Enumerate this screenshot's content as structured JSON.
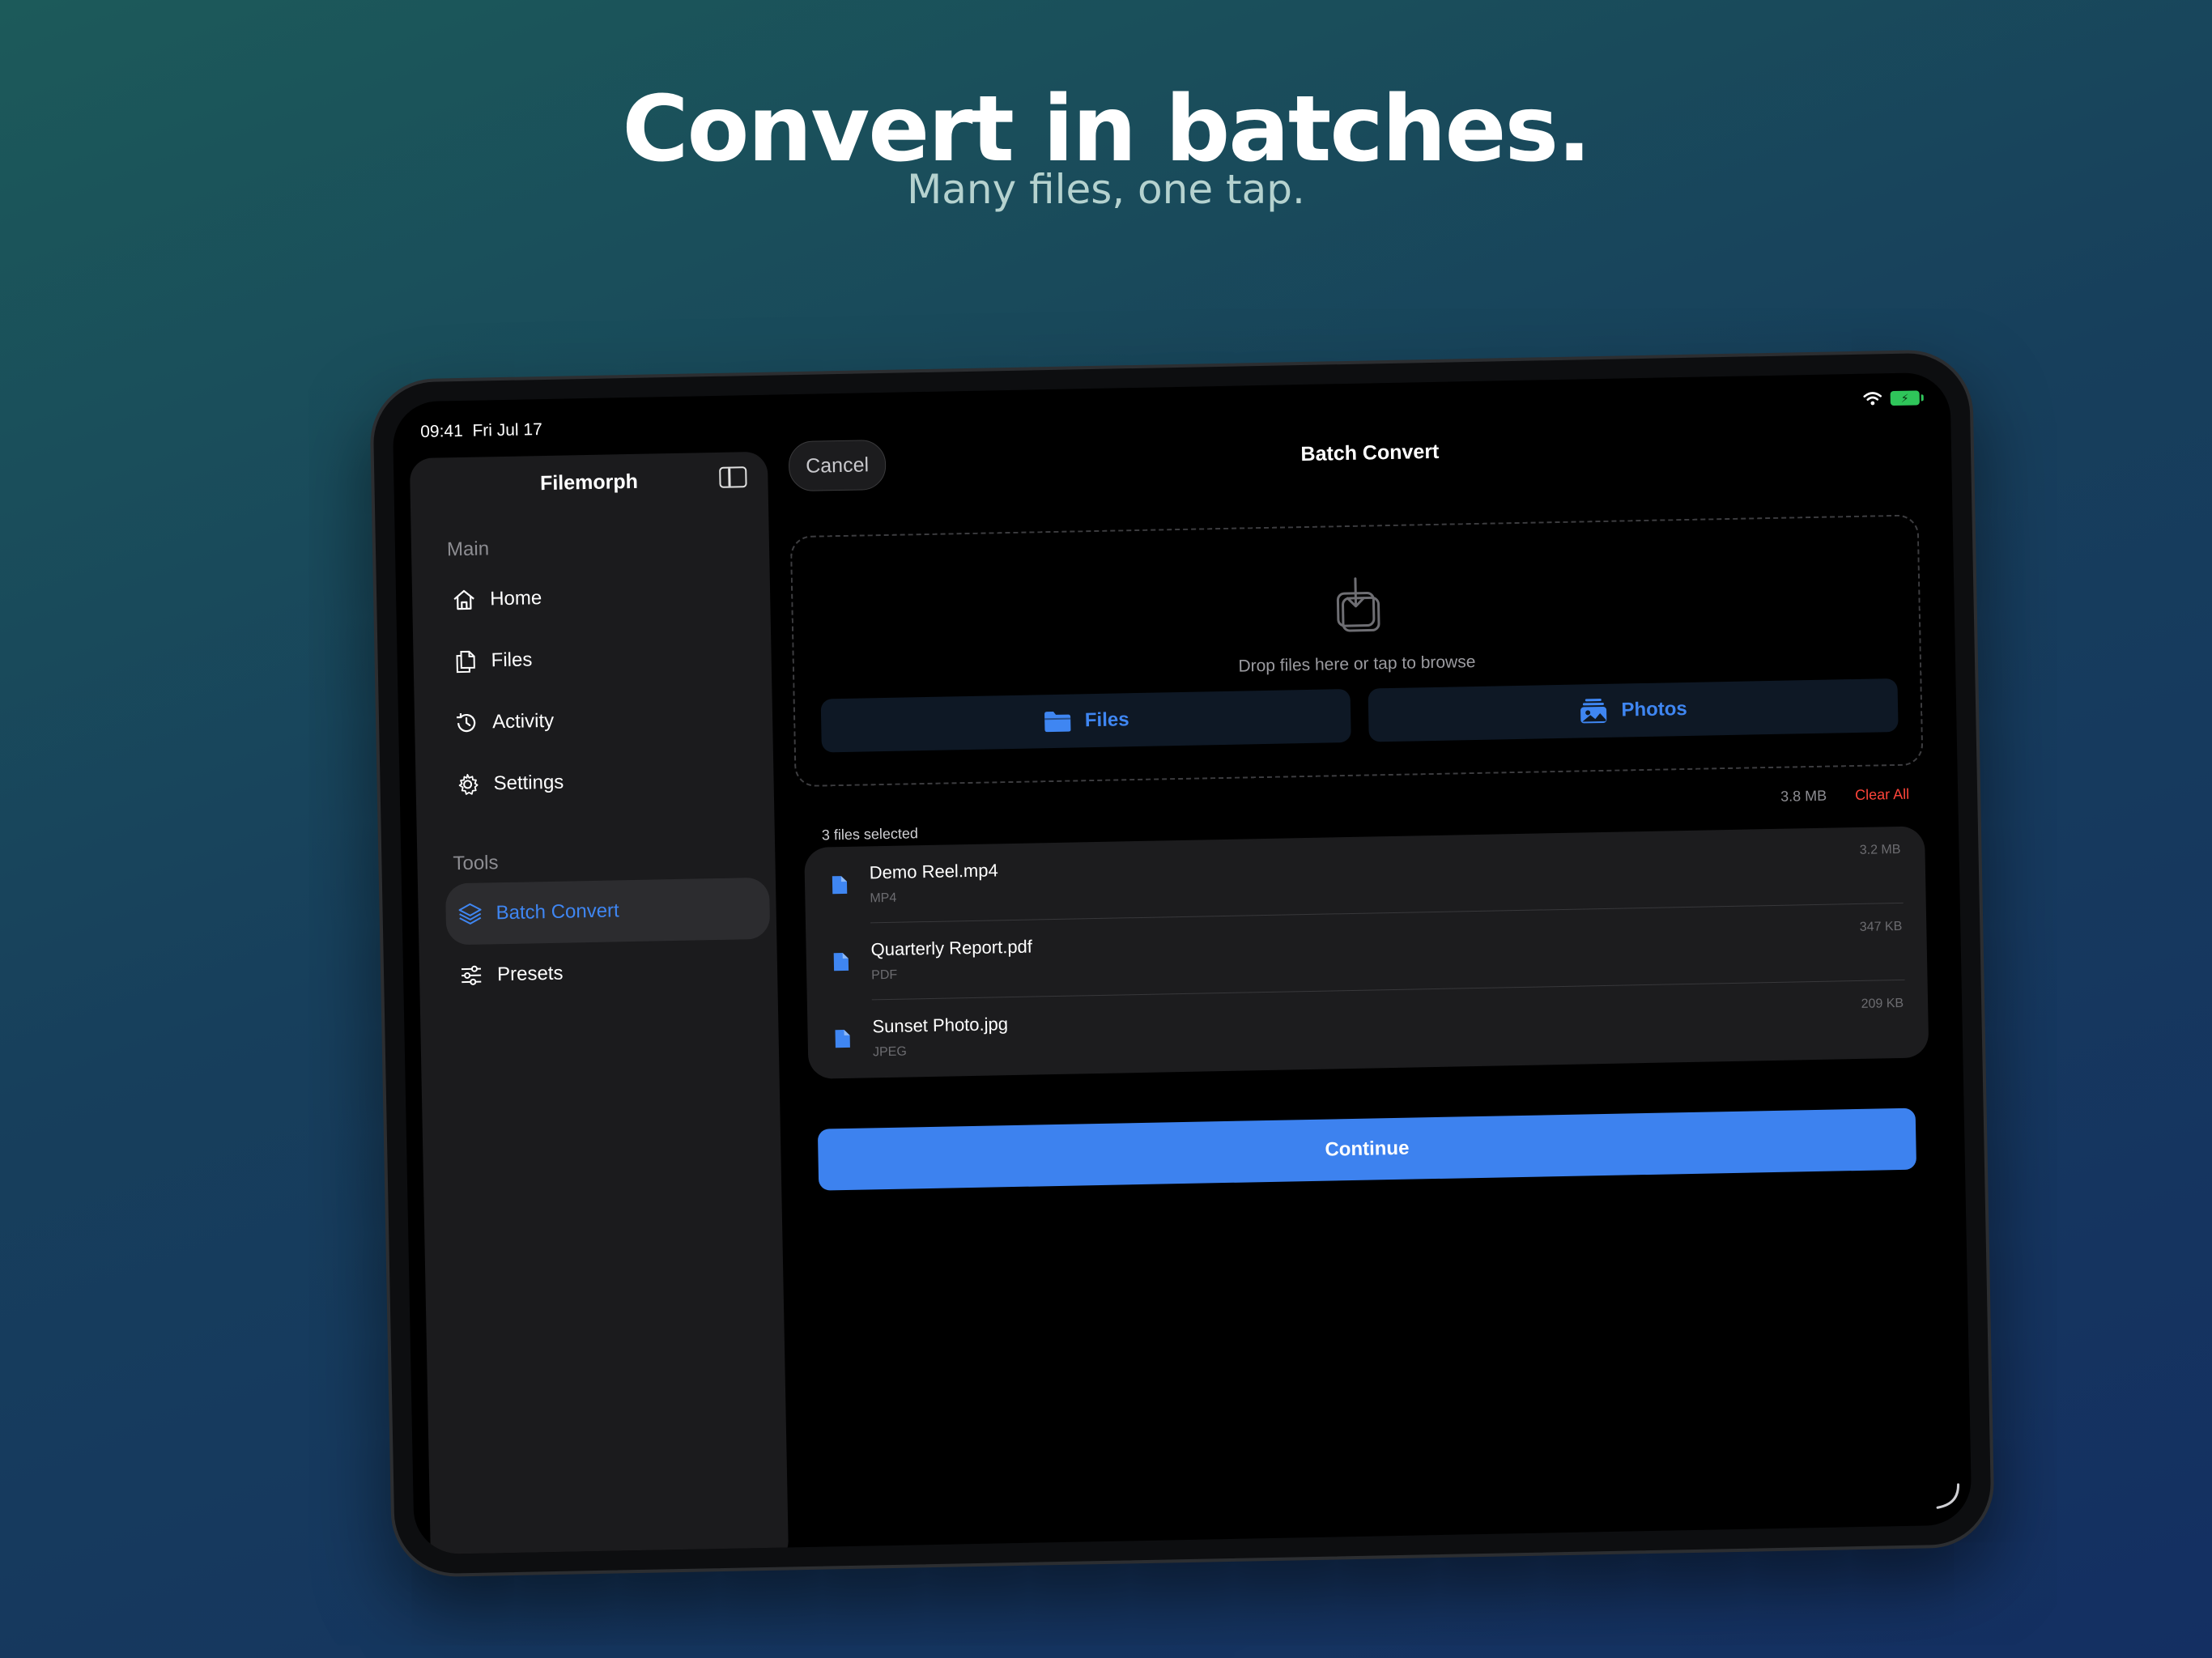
{
  "marketing": {
    "headline": "Convert in batches.",
    "subheadline": "Many files, one tap."
  },
  "status_bar": {
    "time": "09:41",
    "date": "Fri Jul 17",
    "wifi_icon": "wifi-icon",
    "battery_icon": "battery-charging-icon",
    "battery_color": "#2fc55a"
  },
  "sidebar": {
    "title": "Filemorph",
    "toggle_icon": "sidebar-toggle-icon",
    "sections": [
      {
        "label": "Main",
        "items": [
          {
            "label": "Home",
            "icon": "house-icon"
          },
          {
            "label": "Files",
            "icon": "documents-icon"
          },
          {
            "label": "Activity",
            "icon": "clock-history-icon"
          },
          {
            "label": "Settings",
            "icon": "gear-icon"
          }
        ]
      },
      {
        "label": "Tools",
        "items": [
          {
            "label": "Batch Convert",
            "icon": "layers-icon",
            "selected": true
          },
          {
            "label": "Presets",
            "icon": "sliders-icon"
          }
        ]
      }
    ]
  },
  "nav": {
    "cancel_label": "Cancel",
    "title": "Batch Convert"
  },
  "dropzone": {
    "icon": "download-tray-icon",
    "hint": "Drop files here or tap to browse",
    "files_button": "Files",
    "photos_button": "Photos"
  },
  "selection": {
    "count_label": "3 files selected",
    "total_size": "3.8 MB",
    "clear_label": "Clear All"
  },
  "files": [
    {
      "name": "Demo Reel.mp4",
      "type": "MP4",
      "size": "3.2 MB",
      "icon": "document-icon"
    },
    {
      "name": "Quarterly Report.pdf",
      "type": "PDF",
      "size": "347 KB",
      "icon": "document-icon"
    },
    {
      "name": "Sunset Photo.jpg",
      "type": "JPEG",
      "size": "209 KB",
      "icon": "document-icon"
    }
  ],
  "continue_label": "Continue",
  "colors": {
    "accent": "#3d82ef",
    "destructive": "#ff453a",
    "background_start": "#1c5a5a",
    "background_end": "#142f62"
  }
}
